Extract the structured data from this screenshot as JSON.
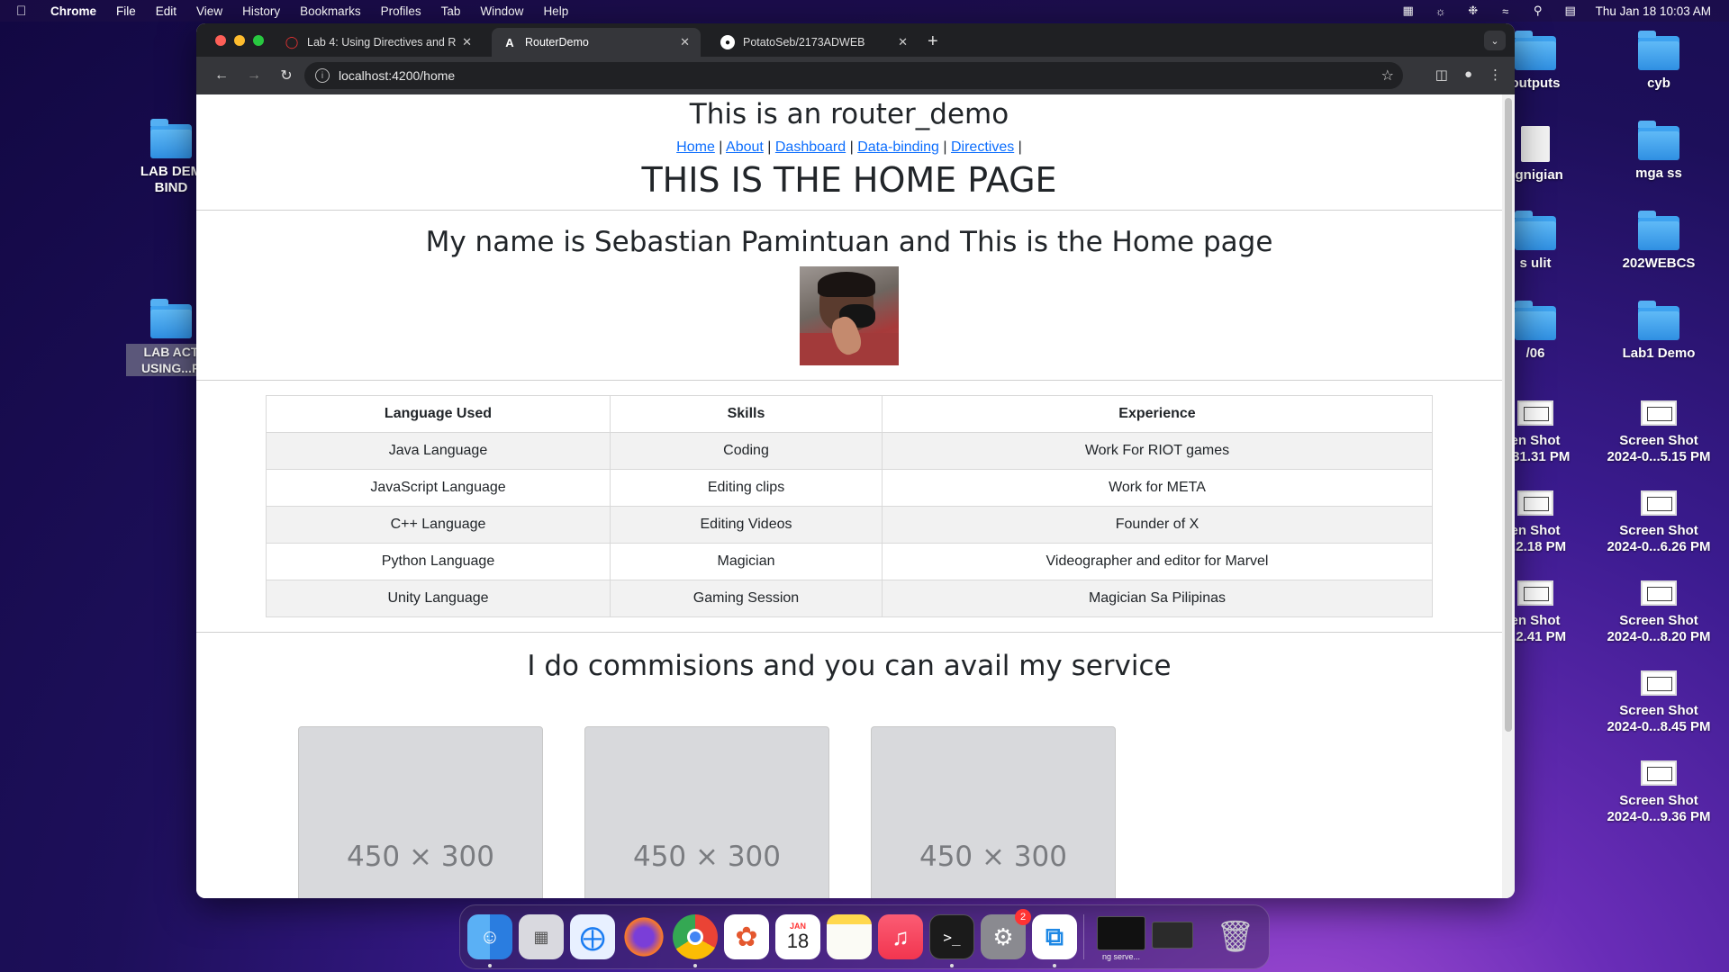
{
  "menubar": {
    "app": "Chrome",
    "items": [
      "File",
      "Edit",
      "View",
      "History",
      "Bookmarks",
      "Profiles",
      "Tab",
      "Window",
      "Help"
    ],
    "clock": "Thu Jan 18  10:03 AM"
  },
  "desktop": {
    "right_col1": [
      {
        "label": "outputs",
        "type": "folder"
      },
      {
        "label": "egnigian",
        "type": "document"
      },
      {
        "label": "s ulit",
        "type": "folder"
      },
      {
        "label": "/06",
        "type": "folder"
      },
      {
        "label": "en Shot\n...31.31 PM",
        "type": "screenshot"
      },
      {
        "label": "en Shot\n...2.18 PM",
        "type": "screenshot"
      },
      {
        "label": "en Shot\n...2.41 PM",
        "type": "screenshot"
      }
    ],
    "right_col2": [
      {
        "label": "cyb",
        "type": "folder"
      },
      {
        "label": "mga ss",
        "type": "folder"
      },
      {
        "label": "202WEBCS",
        "type": "folder"
      },
      {
        "label": "Lab1 Demo",
        "type": "folder"
      },
      {
        "label": "Screen Shot\n2024-0...5.15 PM",
        "type": "screenshot"
      },
      {
        "label": "Screen Shot\n2024-0...6.26 PM",
        "type": "screenshot"
      },
      {
        "label": "Screen Shot\n2024-0...8.20 PM",
        "type": "screenshot"
      },
      {
        "label": "Screen Shot\n2024-0...8.45 PM",
        "type": "screenshot"
      },
      {
        "label": "Screen Shot\n2024-0...9.36 PM",
        "type": "screenshot"
      }
    ],
    "left": [
      {
        "label": "LAB DEM\nBIND"
      },
      {
        "label": "LAB ACT\nUSING...R"
      }
    ]
  },
  "browser": {
    "tabs": [
      {
        "title": "Lab 4: Using Directives and R",
        "icon": "loading-spinner-icon",
        "active": false
      },
      {
        "title": "RouterDemo",
        "icon": "angular-icon",
        "active": true
      },
      {
        "title": "PotatoSeb/2173ADWEB",
        "icon": "github-icon",
        "active": false
      }
    ],
    "url": "localhost:4200/home"
  },
  "page": {
    "app_title": "This is an router_demo",
    "nav": [
      "Home",
      "About",
      "Dashboard",
      "Data-binding",
      "Directives"
    ],
    "heading": "THIS IS THE HOME PAGE",
    "intro": "My name is Sebastian Pamintuan and This is the Home page",
    "table": {
      "headers": [
        "Language Used",
        "Skills",
        "Experience"
      ],
      "rows": [
        [
          "Java Language",
          "Coding",
          "Work For RIOT games"
        ],
        [
          "JavaScript Language",
          "Editing clips",
          "Work for META"
        ],
        [
          "C++ Language",
          "Editing Videos",
          "Founder of X"
        ],
        [
          "Python Language",
          "Magician",
          "Videographer and editor for Marvel"
        ],
        [
          "Unity Language",
          "Gaming Session",
          "Magician Sa Pilipinas"
        ]
      ]
    },
    "commission": "I do commisions and you can avail my service",
    "cards": [
      "450 × 300",
      "450 × 300",
      "450 × 300"
    ]
  },
  "dock": {
    "apps": [
      "finder-icon",
      "launchpad-icon",
      "safari-icon",
      "firefox-icon",
      "chrome-icon",
      "photos-icon",
      "calendar-icon",
      "notes-icon",
      "music-icon",
      "terminal-icon",
      "settings-icon",
      "vscode-icon"
    ],
    "calendar_month": "JAN",
    "calendar_day": "18",
    "settings_badge": "2",
    "minimized_label": "ng serve..."
  }
}
